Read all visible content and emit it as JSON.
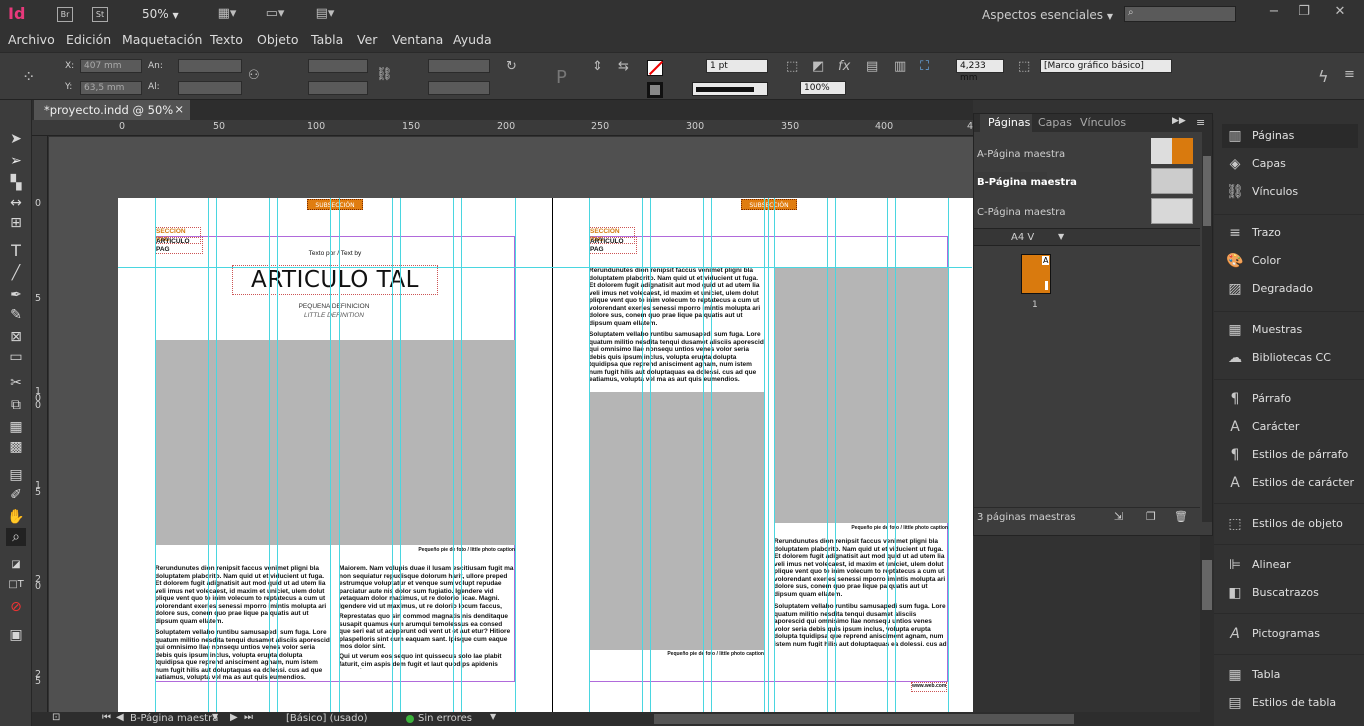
{
  "app": {
    "logo": "Id",
    "bridge": "Br",
    "stock": "St",
    "zoom": "50%",
    "workspace": "Aspectos esenciales",
    "search_placeholder": ""
  },
  "menu": [
    "Archivo",
    "Edición",
    "Maquetación",
    "Texto",
    "Objeto",
    "Tabla",
    "Ver",
    "Ventana",
    "Ayuda"
  ],
  "control": {
    "x_label": "X:",
    "x_val": "407 mm",
    "y_label": "Y:",
    "y_val": "63,5 mm",
    "w_label": "An:",
    "h_label": "Al:",
    "stroke_weight": "1 pt",
    "frame_width": "4,233 mm",
    "opacity": "100%",
    "frame_style": "[Marco gráfico básico]"
  },
  "doc_tab": {
    "name": "*proyecto.indd @ 50%",
    "close": "×"
  },
  "ruler": {
    "top": [
      "0",
      "50",
      "100",
      "150",
      "200",
      "250",
      "300",
      "350",
      "400",
      "4"
    ],
    "left": [
      "0",
      "5",
      "1 0 0",
      "1 5",
      "2 0",
      "2 5"
    ]
  },
  "pages_panel": {
    "tabs": [
      "Páginas",
      "Capas",
      "Vínculos"
    ],
    "masters": [
      "A-Página maestra",
      "B-Página maestra",
      "C-Página maestra"
    ],
    "size": "A4 V",
    "page_number": "1",
    "page_letter": "A",
    "footer": "3 páginas maestras"
  },
  "dock": {
    "group1": [
      "Páginas",
      "Capas",
      "Vínculos"
    ],
    "group2": [
      "Trazo",
      "Color",
      "Degradado"
    ],
    "group3": [
      "Muestras",
      "Bibliotecas CC"
    ],
    "group4": [
      "Párrafo",
      "Carácter",
      "Estilos de párrafo",
      "Estilos de carácter"
    ],
    "group5": [
      "Estilos de objeto"
    ],
    "group6": [
      "Alinear",
      "Buscatrazos"
    ],
    "group7": [
      "Pictogramas"
    ],
    "group8": [
      "Tabla",
      "Estilos de tabla"
    ]
  },
  "doc": {
    "subseccion": "SUBSECCIÓN",
    "seccion_pag": "SECCIÓN PAG",
    "articulo_pag": "ARTÍCULO PAG",
    "text_by": "Texto por / Text by",
    "title": "ARTICULO TAL",
    "pequena": "PEQUEÑA DEFINICIÓN",
    "little": "LITTLE DEFINITION",
    "caption1": "Pequeño pie de foto / little photo caption",
    "body1": "Rerundunutes dion renipsit faccus venimet pligni bla doluptatem plaborito. Nam quid ut et viducient ut fuga. Et dolorem fugit adignatisit aut mod quid ut ad utem lia veli imus net volecaest, id maxim et uniciet, ulem dolut plique vent quo te inim volecum to reptatecus a cum ut volorendant exeries senessi mporro imintis molupta ari dolore sus, conem quo prae lique pa quatis aut ut dipsum quam ellatem.",
    "body2": "Soluptatem vellabo runtibu samusapedi sum fuga. Lore quatum militio nesdita tenqui dusamet alisciis aporescid qui omnisimo llae nonsequ untios venes volor seria debis quis ipsum inclus, volupta erupta dolupta tquidipsa que reprend anisciment agnam, num istem num fugit hilis aut doluptaquas ea dolessi. cus ad que eatiamus, volupta vel ma as aut quis eumendios.",
    "body3": "Maiorem. Nam volupis duae il lusam escitiusam fugit ma non sequiatur repudisque dolorum harit, ullore preped estrumque voluptatur et venque sum volupt repudae parciatur aute nis dolor sum fugiatio. Igendere vid vetaquam dolor maximus, ut re dolorio licae. Magni. Igendere vid ut maximus, ut re dolorio locum faccus, quis re simus denihic iundae. Et labo. Ut fuga.",
    "body4": "Represtatas quo sin commod magnatis nis denditaque susapit quamus eum arumqui temolessus ea consed que seri eat ut aceperunt odi vent ut et aut etur? Hitiore plaspelloris sint cum eaquam sant. Ipisque cum eaque mos dolor sint.",
    "body5": "Qui ut verum eos sequo int quissecus solo lae plabit faturit, cim aspis dem fugit et laut quodips apidenis consedae consedae.",
    "folio": "www.web.com"
  },
  "status": {
    "page": "B-Página maestra",
    "style": "[Básico] (usado)",
    "errors": "Sin errores"
  }
}
